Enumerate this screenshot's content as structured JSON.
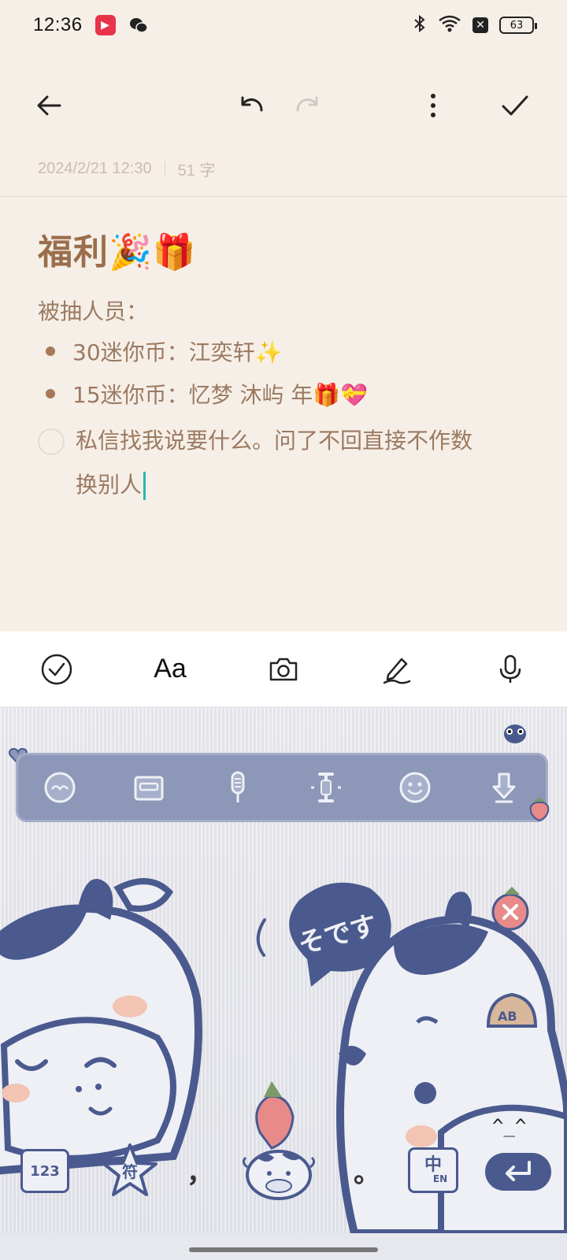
{
  "status_bar": {
    "time": "12:36",
    "battery": "63"
  },
  "meta": {
    "datetime": "2024/2/21 12:30",
    "word_count": "51 字"
  },
  "note": {
    "title": "福利🎉🎁",
    "label": "被抽人员：",
    "bullets": [
      "30迷你币：江奕轩✨",
      "15迷你币：忆梦 沐屿 年🎁💝"
    ],
    "checklist_item_line1": "私信找我说要什么。问了不回直接不作数",
    "checklist_item_line2": "换别人"
  },
  "edit_toolbar": {
    "format_label": "Aa"
  },
  "keyboard": {
    "speech_text": "そです",
    "face_text": "^_^",
    "bell_text": "AB",
    "numbers_key": "123",
    "symbols_key": "符",
    "comma_key": "，",
    "period_key": "。",
    "lang_key_main": "中",
    "lang_key_sub": "EN"
  },
  "colors": {
    "background": "#f6efe7",
    "title": "#9a6e4c",
    "text": "#9b7a62",
    "cursor": "#2ab7a9",
    "keyboard_accent": "#4a5a8e"
  }
}
